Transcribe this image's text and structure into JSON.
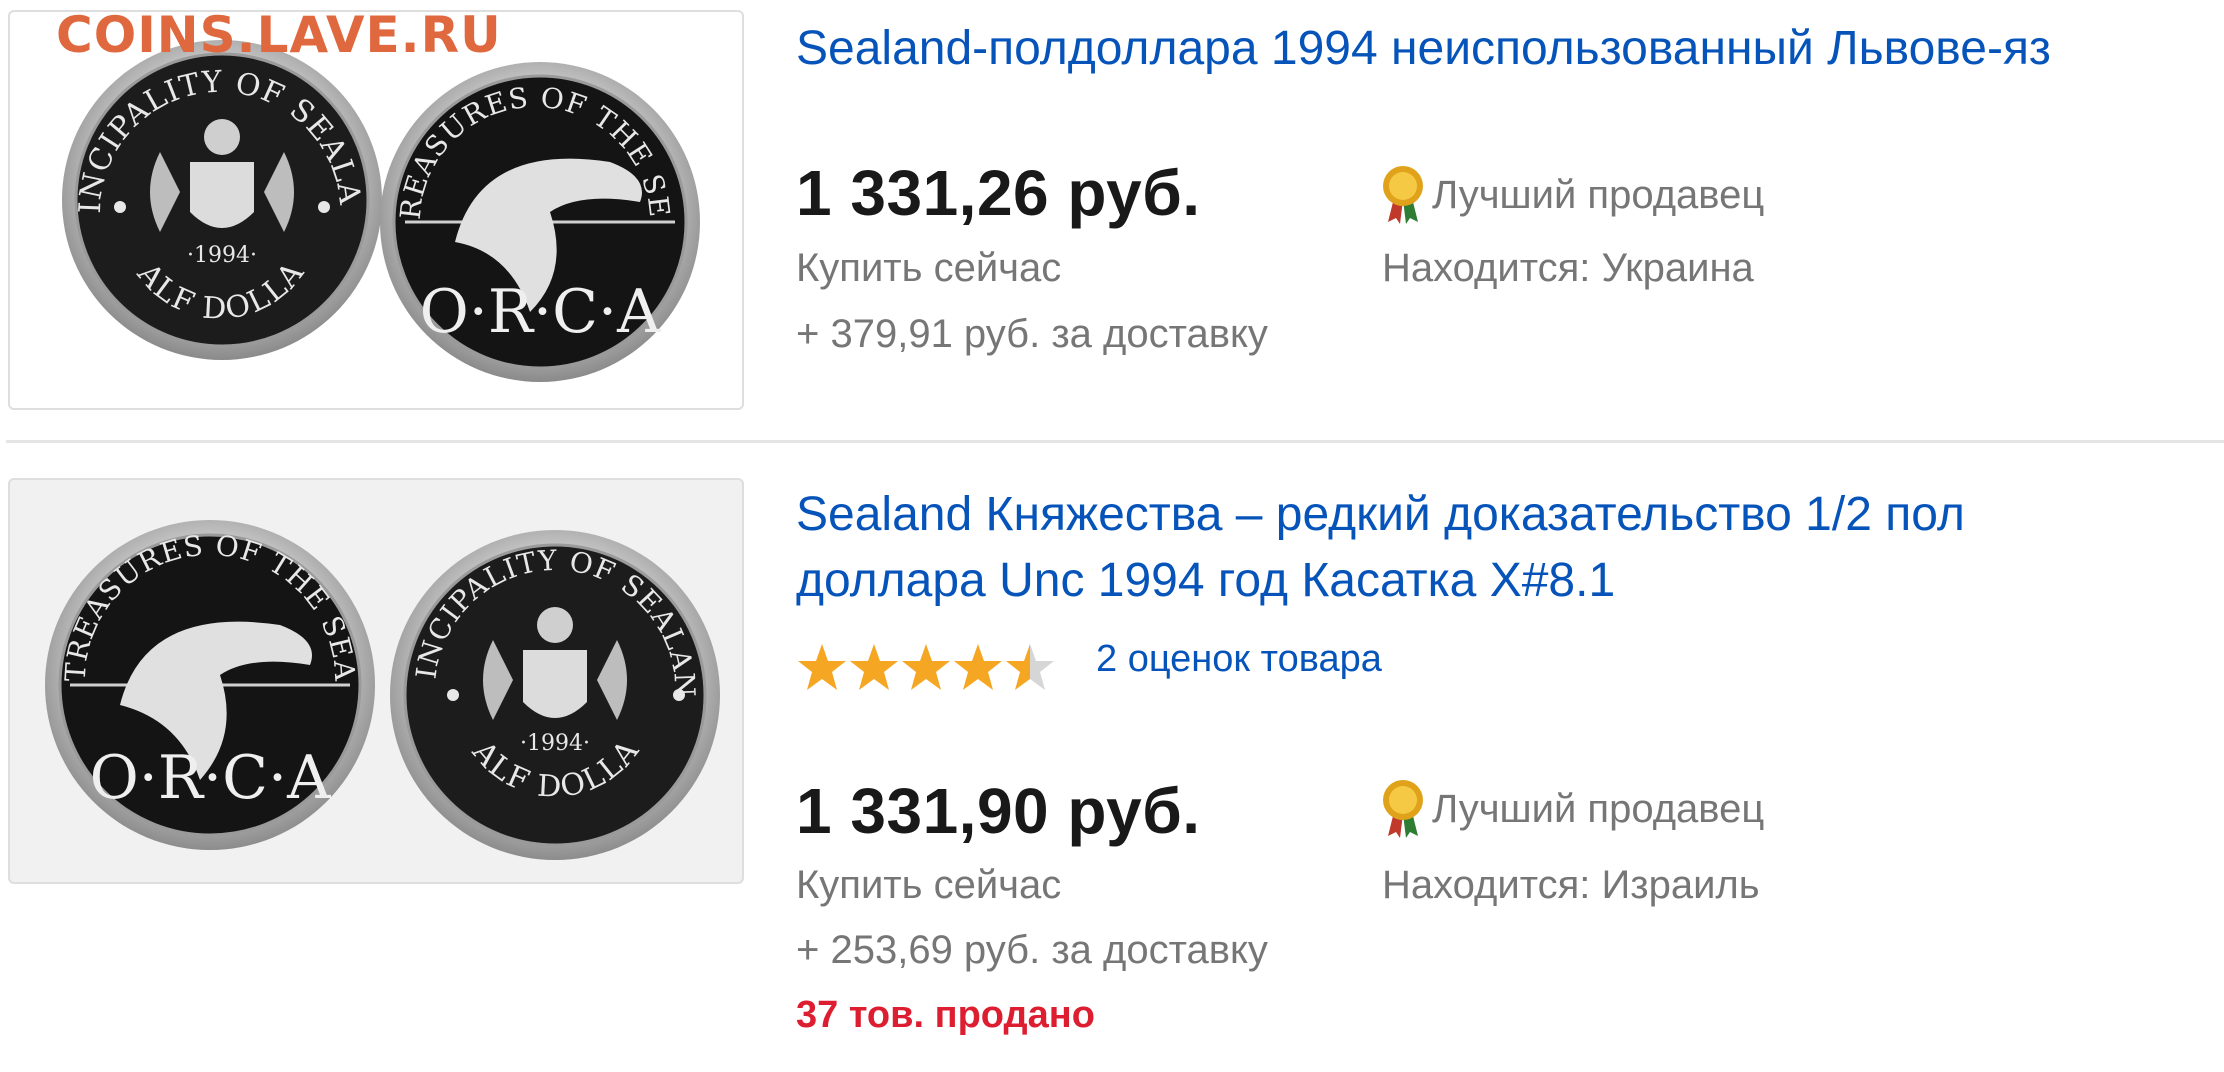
{
  "watermark": "COINS.LAVE.RU",
  "listings": [
    {
      "title_lines": [
        "Sealand-полдоллара 1994 неиспользованный Львове-яз"
      ],
      "price": "1 331,26 руб.",
      "buy_label": "Купить сейчас",
      "shipping": "+ 379,91 руб. за доставку",
      "seller_badge": "Лучший продавец",
      "location": "Находится: Украина",
      "coin_left": {
        "arc": "PRINCIPALITY OF SEALAND",
        "bottom": "HALF DOLLAR",
        "year": "·1994·"
      },
      "coin_right": {
        "arc": "TREASURES OF THE SEA",
        "bottom": "O·R·C·A"
      }
    },
    {
      "title_lines": [
        "Sealand Княжества – редкий доказательство 1/2 пол",
        "доллара Unc 1994 год Касатка X#8.1"
      ],
      "rating": 4.5,
      "reviews": "2 оценок товара",
      "price": "1 331,90 руб.",
      "buy_label": "Купить сейчас",
      "shipping": "+ 253,69 руб. за доставку",
      "sold": "37 тов. продано",
      "seller_badge": "Лучший продавец",
      "location": "Находится: Израиль",
      "coin_left": {
        "arc": "TREASURES OF THE SEA",
        "bottom": "O·R·C·A"
      },
      "coin_right": {
        "arc": "PRINCIPALITY OF SEALAND",
        "bottom": "HALF DOLLAR",
        "year": "·1994·"
      }
    }
  ],
  "colors": {
    "link": "#0654ba",
    "muted": "#767676",
    "sold": "#dd1e31",
    "star": "#f5a623",
    "watermark": "#e0683f"
  },
  "icons": {
    "seller": "award-ribbon-icon",
    "rating": "star-icon"
  }
}
